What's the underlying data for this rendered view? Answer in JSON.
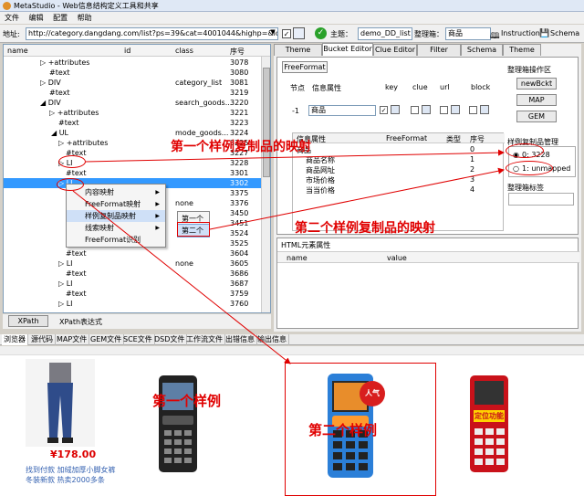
{
  "window": {
    "title": "MetaStudio - Web信息结构定义工具和共享"
  },
  "menu": [
    "文件",
    "编辑",
    "配置",
    "帮助"
  ],
  "address": {
    "label": "地址:",
    "url": "http://category.dangdang.com/list?ps=39&cat=4001044&highp=&lowp",
    "theme_label": "主题：",
    "theme_value": "demo_DD_list",
    "bucket_label": "整理箱：",
    "bucket_value": "商品",
    "instruction": "Instruction",
    "schema": "Schema"
  },
  "tree": {
    "headers": {
      "name": "name",
      "id": "id",
      "class": "class",
      "seq": "序号"
    },
    "rows": [
      {
        "name": "▷ +attributes",
        "indent": 40,
        "class": "",
        "seq": "3078"
      },
      {
        "name": "#text",
        "indent": 50,
        "class": "",
        "seq": "3080"
      },
      {
        "name": "▷ DIV",
        "indent": 40,
        "class": "category_list",
        "seq": "3081"
      },
      {
        "name": "#text",
        "indent": 50,
        "class": "",
        "seq": "3219"
      },
      {
        "name": "◢ DIV",
        "indent": 40,
        "class": "search_goods...",
        "seq": "3220"
      },
      {
        "name": "▷ +attributes",
        "indent": 50,
        "class": "",
        "seq": "3221"
      },
      {
        "name": "#text",
        "indent": 60,
        "class": "",
        "seq": "3223"
      },
      {
        "name": "◢ UL",
        "indent": 52,
        "class": "mode_goods...",
        "seq": "3224"
      },
      {
        "name": "▷ +attributes",
        "indent": 60,
        "class": "",
        "seq": "3225"
      },
      {
        "name": "#text",
        "indent": 68,
        "class": "",
        "seq": "3227"
      },
      {
        "name": "▷ LI",
        "indent": 60,
        "class": "",
        "seq": "3228"
      },
      {
        "name": "#text",
        "indent": 68,
        "class": "",
        "seq": "3301"
      },
      {
        "name": "▷ LI",
        "indent": 60,
        "class": "",
        "seq": "3302"
      },
      {
        "name": "",
        "indent": 68,
        "class": "",
        "seq": "3375"
      },
      {
        "name": "",
        "indent": 60,
        "class": "none",
        "seq": "3376"
      },
      {
        "name": "",
        "indent": 68,
        "class": "",
        "seq": "3450"
      },
      {
        "name": "",
        "indent": 60,
        "class": "",
        "seq": "3451"
      },
      {
        "name": "",
        "indent": 68,
        "class": "",
        "seq": "3524"
      },
      {
        "name": "",
        "indent": 60,
        "class": "",
        "seq": "3525"
      },
      {
        "name": "#text",
        "indent": 68,
        "class": "",
        "seq": "3604"
      },
      {
        "name": "▷ LI",
        "indent": 60,
        "class": "none",
        "seq": "3605"
      },
      {
        "name": "#text",
        "indent": 68,
        "class": "",
        "seq": "3686"
      },
      {
        "name": "▷ LI",
        "indent": 60,
        "class": "",
        "seq": "3687"
      },
      {
        "name": "#text",
        "indent": 68,
        "class": "",
        "seq": "3759"
      },
      {
        "name": "▷ LI",
        "indent": 60,
        "class": "",
        "seq": "3760"
      }
    ],
    "selected_index": 12
  },
  "xpath": {
    "button": "XPath",
    "label": "XPath表达式"
  },
  "right_tabs": [
    "Theme Editor",
    "Bucket Editor",
    "Clue Editor",
    "Filter Editor",
    "Schema List",
    "Theme List"
  ],
  "bucket": {
    "ff_chip": "FreeFormat",
    "headers": {
      "node": "节点",
      "attr": "信息属性",
      "key": "key",
      "clue": "clue",
      "url": "url",
      "block": "block"
    },
    "row_node": "-1",
    "row_attr": "商品",
    "grid_headers": {
      "attr": "信息属性",
      "ff": "FreeFormat",
      "type": "类型",
      "seq": "序号"
    },
    "grid_rows": [
      {
        "attr": "商品",
        "seq": "0"
      },
      {
        "attr": "商品名称",
        "seq": "1"
      },
      {
        "attr": "商品网址",
        "seq": "2"
      },
      {
        "attr": "市场价格",
        "seq": "3"
      },
      {
        "attr": "当当价格",
        "seq": "4"
      }
    ]
  },
  "side": {
    "ops_title": "整理箱操作区",
    "btn_new": "newBckt",
    "btn_map": "MAP",
    "btn_gem": "GEM",
    "sample_title": "样例复制品管理",
    "sample_0": "0: 3228",
    "sample_1": "1: unmapped",
    "tag_title": "整理箱标签"
  },
  "html_attr": {
    "title": "HTML元素属性",
    "col_name": "name",
    "col_value": "value"
  },
  "context_menu": {
    "items": [
      "内容映射",
      "FreeFormat映射",
      "样例复制品映射",
      "线索映射",
      "FreeFormat识别"
    ],
    "submenu": [
      "第一个",
      "第二个"
    ]
  },
  "annotations": {
    "first_copy_map": "第一个样例复制品的映射",
    "second_copy_map": "第二个样例复制品的映射",
    "first_sample": "第一个样例",
    "second_sample": "第二个样例"
  },
  "browser_tabs": [
    "浏览器",
    "源代码",
    "MAP文件",
    "GEM文件",
    "SCE文件",
    "DSD文件",
    "工作流文件",
    "出错信息",
    "输出信息"
  ],
  "products": {
    "price": "¥178.00",
    "desc1": "找到付款 加绒加厚小脚女裤",
    "desc2": "冬装新款 热卖2000多条",
    "badge": "人气",
    "red_phone_label": "定位功能"
  },
  "colors": {
    "annotation": "#e00000",
    "selection": "#3399ff",
    "link": "#3360b0"
  }
}
